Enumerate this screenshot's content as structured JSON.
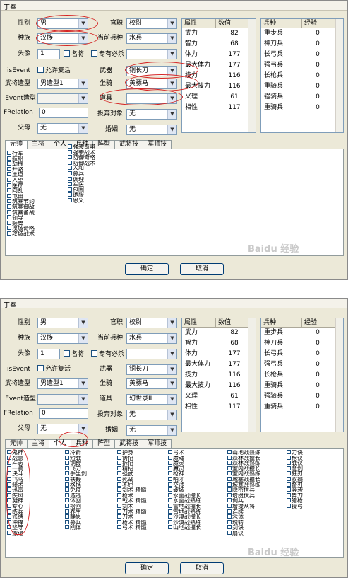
{
  "window_title": "丁奉",
  "labels": {
    "gender": "性别",
    "race": "种族",
    "portrait": "头像",
    "isevent": "isEvent",
    "model": "武将造型",
    "event_model": "Event造型",
    "frelation": "FRelation",
    "parents": "父母",
    "rank": "官职",
    "current_troop": "当前兵种",
    "skill_must": "专有必杀",
    "weapon": "武器",
    "mount": "坐骑",
    "item": "道具",
    "defect_target": "投奔对象",
    "spouse": "婚姻",
    "fame_cb": "名将",
    "revive_cb": "允许复活"
  },
  "values": {
    "gender": "男",
    "race": "汉族",
    "portrait": "1",
    "model": "男造型1",
    "frelation": "0",
    "parents": "无",
    "rank": "校尉",
    "current_troop": "水兵",
    "weapon": "铜长刀",
    "mount": "黄骠马",
    "item_1": "",
    "item_2": "幻世录II",
    "defect_target": "无",
    "spouse": "无"
  },
  "attr_table": {
    "headers": [
      "属性",
      "数值"
    ],
    "rows": [
      [
        "武力",
        "82"
      ],
      [
        "智力",
        "68"
      ],
      [
        "体力",
        "177"
      ],
      [
        "最大体力",
        "177"
      ],
      [
        "技力",
        "116"
      ],
      [
        "最大技力",
        "116"
      ],
      [
        "义理",
        "61"
      ],
      [
        "相性",
        "117"
      ]
    ]
  },
  "troop_table": {
    "headers": [
      "兵种",
      "经验"
    ],
    "rows": [
      [
        "重步兵",
        "0"
      ],
      [
        "神刀兵",
        "0"
      ],
      [
        "长弓兵",
        "0"
      ],
      [
        "强弓兵",
        "0"
      ],
      [
        "长枪兵",
        "0"
      ],
      [
        "重骑兵",
        "0"
      ],
      [
        "强骑兵",
        "0"
      ],
      [
        "重骑兵",
        "0"
      ]
    ]
  },
  "tabs": [
    "元帅",
    "主将",
    "个人",
    "兵种",
    "阵型",
    "武将技",
    "军师技"
  ],
  "panel1_columns": [
    [
      "行军",
      "航船",
      "劫掠",
      "开路",
      "王道",
      "人望",
      "医疗",
      "向乱",
      "屯田",
      "筑寨节约",
      "筑寨御敌",
      "筑寨备战",
      "领导",
      "鼓舞",
      "攻城奇略",
      "攻城战术"
    ],
    [
      "强袭奇略",
      "强袭战术",
      "防御奇略",
      "防御战术",
      "人和",
      "募兵",
      "调理",
      "军医",
      "包围",
      "诡服",
      "恩义"
    ]
  ],
  "panel2_columns": [
    [
      "鬼神",
      "战意",
      "斗志",
      "一骑",
      "决斗",
      "飞马",
      "骑术",
      "迅雷",
      "疾风",
      "凝神",
      "专心",
      "练兵",
      "修缮",
      "冲锋",
      "坚守",
      "撤退"
    ],
    [
      "冷箭",
      "短戟",
      "铜鞭",
      "飞刀",
      "手里剑",
      "铁鞭",
      "格挡",
      "免疫",
      "遁逃",
      "体回",
      "拾回",
      "养生",
      "静思",
      "募兵",
      "刚体"
    ],
    [
      "护身",
      "铸招",
      "拆招",
      "精招",
      "强武",
      "死战",
      "不屈",
      "剑术 精髓",
      "枪术",
      "戟术 精髓",
      "剑术",
      "刀术 精髓",
      "刀术",
      "枪术 精髓",
      "弓术 精髓"
    ],
    [
      "弓术",
      "魔魂",
      "魔灵",
      "魔灵",
      "枪神",
      "哨才",
      "交涉",
      "破城",
      "水面战撞长",
      "水面战熟练",
      "雪地战撞长",
      "雪地战熟练",
      "沙漠战撞长",
      "沙漠战熟练",
      "山地战撞长"
    ],
    [
      "山地战熟练",
      "森林战撞长",
      "森林战熟练",
      "室内战撞长",
      "室内战熟练",
      "城塞战撞长",
      "城塞战熟练",
      "隐密伏兵",
      "增援伏兵",
      "调兵",
      "增援从将",
      "连续",
      "念体",
      "魂转",
      "剑诀",
      "扇诀"
    ],
    [
      "刀诀",
      "枪诀",
      "戟诀",
      "慧剑",
      "狂刃",
      "驭鎚",
      "鳌刃",
      "奔袭",
      "舞刀",
      "猎枪",
      "操弓"
    ]
  ],
  "panel2_checked": [
    "练兵",
    "修缮",
    "冲锋",
    "坚守",
    "撤退"
  ],
  "buttons": {
    "ok": "确定",
    "cancel": "取消"
  },
  "watermark": "Baidu 经验",
  "colors": {
    "annotation_red": "#d42323",
    "window_bg": "#ece9d8"
  }
}
